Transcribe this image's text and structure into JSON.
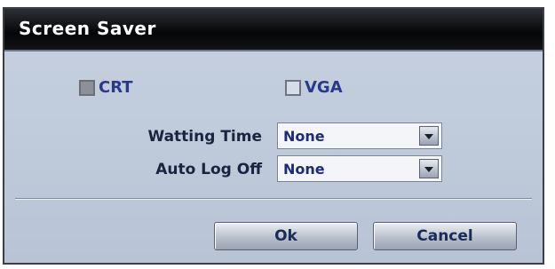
{
  "dialog": {
    "title": "Screen Saver",
    "outputs": [
      {
        "label": "CRT",
        "checked": true
      },
      {
        "label": "VGA",
        "checked": false
      }
    ],
    "fields": {
      "waiting_time": {
        "label": "Watting Time",
        "value": "None"
      },
      "auto_log_off": {
        "label": "Auto Log Off",
        "value": "None"
      }
    },
    "buttons": {
      "ok": "Ok",
      "cancel": "Cancel"
    }
  }
}
